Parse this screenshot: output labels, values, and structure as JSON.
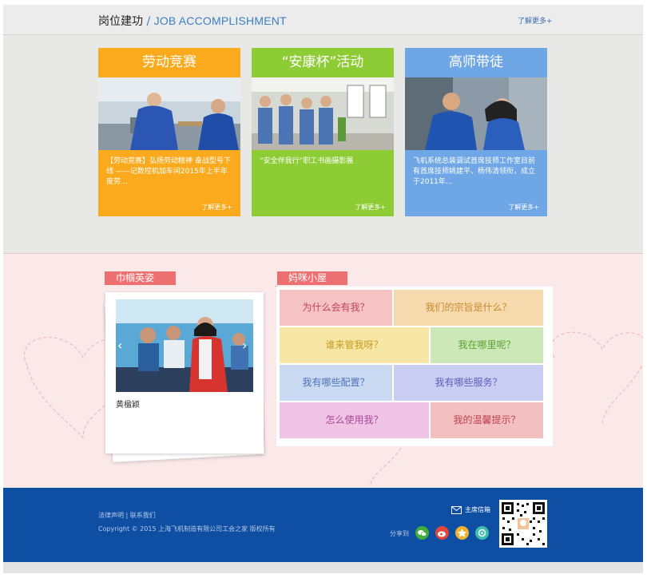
{
  "header": {
    "title_cn": "岗位建功",
    "title_sep": " / ",
    "title_en": "JOB ACCOMPLISHMENT",
    "more": "了解更多+"
  },
  "cards": [
    {
      "title": "劳动竞赛",
      "text": "【劳动竞赛】弘扬劳动精神 奋战型号下线 ——记数控机加车间2015年上半年度劳...",
      "more": "了解更多+",
      "color": "#fba91d"
    },
    {
      "title": "“安康杯”活动",
      "text": "“安全伴我行”职工书画摄影展",
      "more": "了解更多+",
      "color": "#8dcc34"
    },
    {
      "title": "高师带徒",
      "text": "飞机系统总装调试首席技师工作室目前有首席技师姚建平、杨伟清领衔，成立于2011年...",
      "more": "了解更多+",
      "color": "#6fa6e6"
    }
  ],
  "women": {
    "tag": "巾帼英姿",
    "photo_name": "黄楹颖",
    "arrow_left": "‹",
    "arrow_right": "›"
  },
  "mom": {
    "tag": "妈咪小屋",
    "cells": [
      {
        "label": "为什么会有我？",
        "bg": "#f5c3c3",
        "fg": "#c0445c"
      },
      {
        "label": "我们的宗旨是什么？",
        "bg": "#f6d9ad",
        "fg": "#c98a2a"
      },
      {
        "label": "谁来管我呀？",
        "bg": "#f6e7a6",
        "fg": "#c79b1e"
      },
      {
        "label": "我在哪里呢？",
        "bg": "#cde8b8",
        "fg": "#5aa030"
      },
      {
        "label": "我有哪些配置？",
        "bg": "#c9daf2",
        "fg": "#4d72b8"
      },
      {
        "label": "我有哪些服务？",
        "bg": "#c9cdf2",
        "fg": "#5a5fb8"
      },
      {
        "label": "怎么使用我？",
        "bg": "#f0c4e4",
        "fg": "#a8479a"
      },
      {
        "label": "我的温馨提示？",
        "bg": "#f2c0c0",
        "fg": "#c04050"
      }
    ]
  },
  "footer": {
    "links": "法律声明 | 联系我们",
    "copyright": "Copyright © 2015 上海飞机制造有限公司工会之家 版权所有",
    "mailbox": "主席信箱",
    "share": "分享到",
    "share_icons": [
      "wechat-icon",
      "weibo-icon",
      "qzone-icon",
      "pengyou-icon"
    ]
  }
}
